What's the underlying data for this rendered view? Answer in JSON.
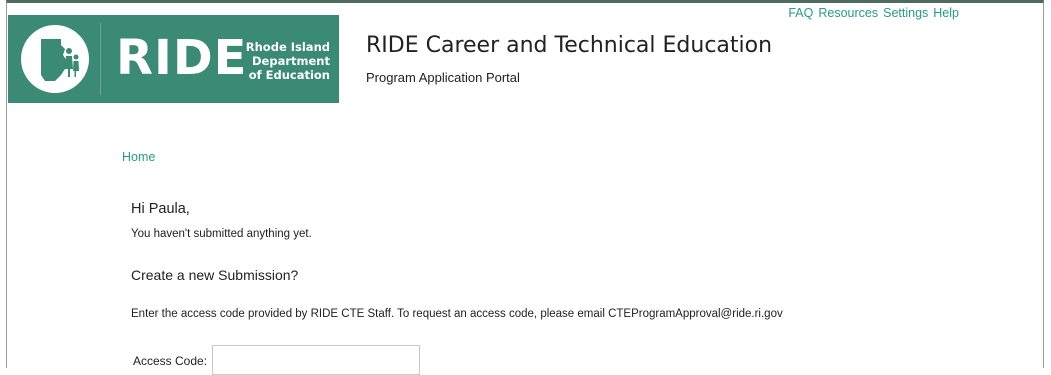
{
  "header": {
    "logo": {
      "word": "RIDE",
      "subtitle_lines": [
        "Rhode Island",
        "Department",
        "of Education"
      ]
    },
    "title": "RIDE Career and Technical Education",
    "subtitle": "Program Application Portal",
    "nav": [
      {
        "label": "FAQ"
      },
      {
        "label": "Resources"
      },
      {
        "label": "Settings"
      },
      {
        "label": "Help"
      }
    ]
  },
  "breadcrumb": {
    "home_label": "Home"
  },
  "main": {
    "greeting": "Hi Paula,",
    "status_text": "You haven't submitted anything yet.",
    "create_heading": "Create a new Submission?",
    "instructions": "Enter the access code provided by RIDE CTE Staff. To request an access code, please email CTEProgramApproval@ride.ri.gov",
    "access_code": {
      "label": "Access Code:",
      "value": "",
      "placeholder": ""
    }
  },
  "colors": {
    "brand_green": "#3a8a76",
    "link_teal": "#2a9a86",
    "top_border": "#4e6b60"
  }
}
